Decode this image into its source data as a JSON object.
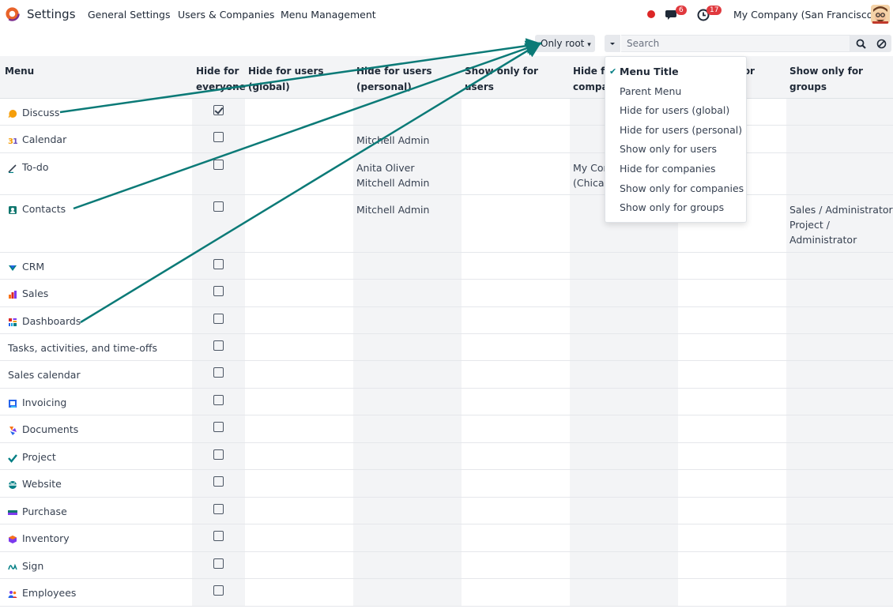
{
  "topbar": {
    "app_name": "Settings",
    "menu": [
      "General Settings",
      "Users & Companies",
      "Menu Management"
    ],
    "chat_badge": "6",
    "activity_badge": "17",
    "company": "My Company (San Francisco)"
  },
  "controls": {
    "filter_button": "Only root",
    "search_placeholder": "Search"
  },
  "table": {
    "columns": [
      "Menu",
      "Hide for everyone",
      "Hide for users (global)",
      "Hide for users (personal)",
      "Show only for users",
      "Hide for companies",
      "Show only for companies",
      "Show only for groups"
    ],
    "rows": [
      {
        "label": "Discuss",
        "icon": "discuss-icon",
        "checked": true
      },
      {
        "label": "Calendar",
        "icon": "calendar-icon",
        "checked": false,
        "personal": [
          "Mitchell Admin"
        ]
      },
      {
        "label": "To-do",
        "icon": "todo-icon",
        "checked": false,
        "personal": [
          "Anita Oliver",
          "Mitchell Admin"
        ],
        "companies": [
          "My Company",
          "(Chicago)"
        ]
      },
      {
        "label": "Contacts",
        "icon": "contacts-icon",
        "checked": false,
        "personal": [
          "Mitchell Admin"
        ],
        "groups": [
          "Sales / Administrator",
          "Project /",
          "Administrator"
        ]
      },
      {
        "label": "CRM",
        "icon": "crm-icon",
        "checked": false
      },
      {
        "label": "Sales",
        "icon": "sales-icon",
        "checked": false
      },
      {
        "label": "Dashboards",
        "icon": "dashboards-icon",
        "checked": false
      },
      {
        "label": "Tasks, activities, and time-offs",
        "icon": "",
        "checked": false
      },
      {
        "label": "Sales calendar",
        "icon": "",
        "checked": false
      },
      {
        "label": "Invoicing",
        "icon": "invoicing-icon",
        "checked": false
      },
      {
        "label": "Documents",
        "icon": "documents-icon",
        "checked": false
      },
      {
        "label": "Project",
        "icon": "project-icon",
        "checked": false
      },
      {
        "label": "Website",
        "icon": "website-icon",
        "checked": false
      },
      {
        "label": "Purchase",
        "icon": "purchase-icon",
        "checked": false
      },
      {
        "label": "Inventory",
        "icon": "inventory-icon",
        "checked": false
      },
      {
        "label": "Sign",
        "icon": "sign-icon",
        "checked": false
      },
      {
        "label": "Employees",
        "icon": "employees-icon",
        "checked": false
      }
    ]
  },
  "dropdown": {
    "items": [
      "Menu Title",
      "Parent Menu",
      "Hide for users (global)",
      "Hide for users (personal)",
      "Show only for users",
      "Hide for companies",
      "Show only for companies",
      "Show only for groups"
    ],
    "selected": "Menu Title"
  },
  "colors": {
    "accent": "#017e84",
    "badge": "#e0393e",
    "arrow": "#0b7a77"
  }
}
